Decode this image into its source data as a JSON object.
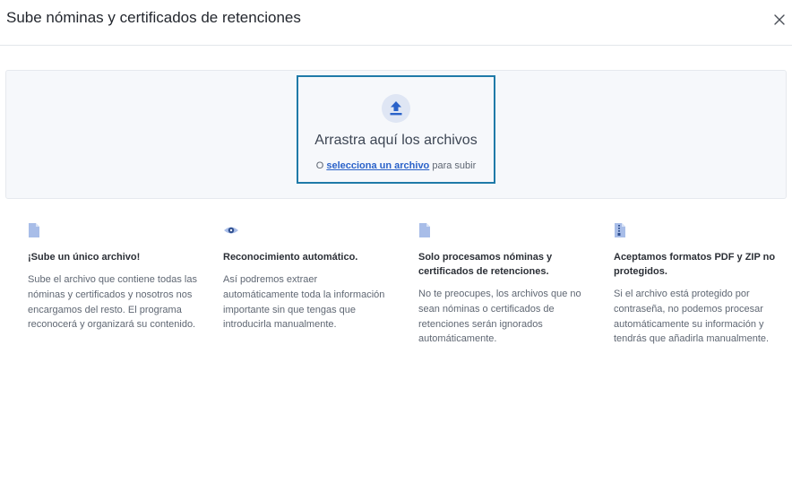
{
  "modal": {
    "title": "Sube nóminas y certificados de retenciones",
    "close_icon": "close-icon"
  },
  "dropzone": {
    "icon": "upload-icon",
    "title": "Arrastra aquí los archivos",
    "prefix": "O",
    "link": "selecciona un archivo",
    "suffix": "para subir"
  },
  "features": [
    {
      "icon": "document-icon",
      "title": "¡Sube un único archivo!",
      "description": "Sube el archivo que contiene todas las nóminas y certificados y nosotros nos encargamos del resto. El programa reconocerá y organizará su contenido."
    },
    {
      "icon": "eye-icon",
      "title": "Reconocimiento automático.",
      "description": "Así podremos extraer automáticamente toda la información importante sin que tengas que introducirla manualmente."
    },
    {
      "icon": "document-icon",
      "title": "Solo procesamos nóminas y certificados de retenciones.",
      "description": "No te preocupes, los archivos que no sean nóminas o certificados de retenciones serán ignorados automáticamente."
    },
    {
      "icon": "zip-file-icon",
      "title": "Aceptamos formatos PDF y ZIP no protegidos.",
      "description": "Si el archivo está protegido por contraseña, no podemos procesar automáticamente su información y tendrás que añadirla manualmente."
    }
  ],
  "colors": {
    "accent": "#2a62c9",
    "dropzone_border": "#1f7aa8",
    "icon_tint": "#a8bde8",
    "panel_bg": "#f6f8fb"
  }
}
